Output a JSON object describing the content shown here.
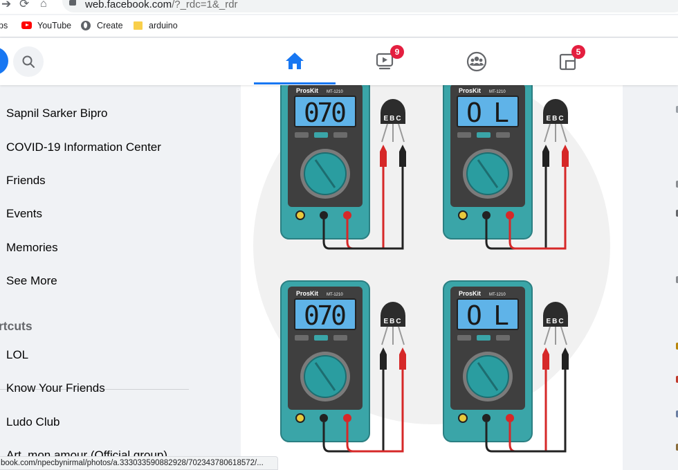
{
  "browser": {
    "url_host": "web.facebook.com",
    "url_path": "/?_rdc=1&_rdr",
    "bookmarks": [
      "ps",
      "YouTube",
      "Create",
      "arduino"
    ]
  },
  "fb_nav": {
    "watch_badge": "9",
    "gaming_badge": "5"
  },
  "sidebar": {
    "items": [
      "Sapnil Sarker Bipro",
      "COVID-19 Information Center",
      "Friends",
      "Events",
      "Memories",
      "See More"
    ],
    "shortcuts_heading": "rtcuts",
    "shortcuts": [
      "LOL",
      "Know Your Friends",
      "Ludo Club",
      "Art, mon amour (Official group)"
    ]
  },
  "post": {
    "meters": [
      {
        "display": "070",
        "brand": "ProsKit",
        "model": "MT-1210"
      },
      {
        "display": "OL",
        "brand": "ProsKit",
        "model": "MT-1210"
      },
      {
        "display": "070",
        "brand": "ProsKit",
        "model": "MT-1210"
      },
      {
        "display": "OL",
        "brand": "ProsKit",
        "model": "MT-1210"
      }
    ],
    "transistor_pins": "EBC"
  },
  "status_link": "book.com/npecbynirmal/photos/a.333033590882928/702343780618572/...",
  "colors": {
    "fb_blue": "#1877f2",
    "badge_red": "#e41e3f",
    "meter_teal": "#3aa5a8",
    "lcd_blue": "#5fb3e8"
  }
}
